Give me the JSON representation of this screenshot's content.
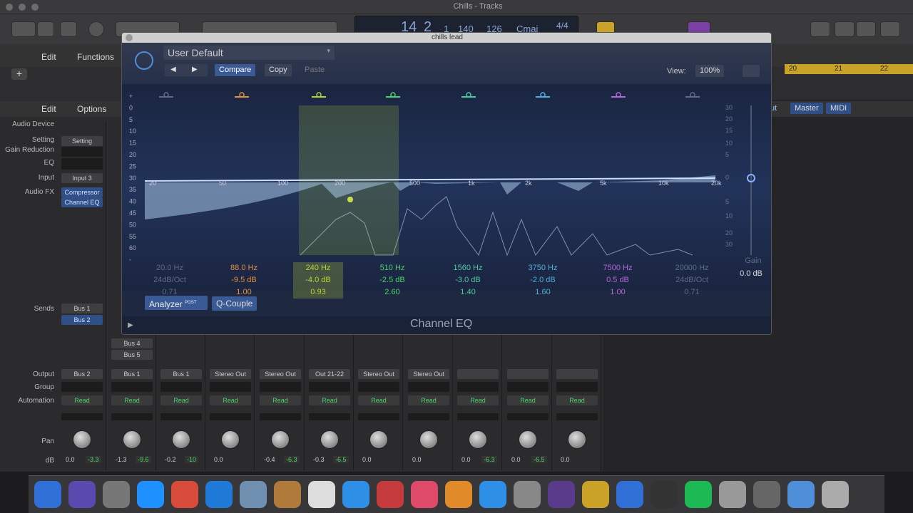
{
  "window": {
    "title": "Chills - Tracks"
  },
  "lcd": {
    "bar": "14",
    "beat": "2",
    "div": "1",
    "tick": "140",
    "tempo": "126",
    "key": "Cmaj",
    "sig": "4/4"
  },
  "tracks_header": {
    "edit": "Edit",
    "functions": "Functions"
  },
  "ruler": [
    "20",
    "21",
    "22"
  ],
  "mixer_header": {
    "edit": "Edit",
    "options": "Options"
  },
  "right_header": [
    "ut",
    "Master",
    "MIDI"
  ],
  "row_labels": {
    "audio_device": "Audio Device",
    "setting": "Setting",
    "gain_reduction": "Gain Reduction",
    "eq": "EQ",
    "input": "Input",
    "audio_fx": "Audio FX",
    "sends": "Sends",
    "output": "Output",
    "group": "Group",
    "automation": "Automation",
    "pan": "Pan",
    "db": "dB"
  },
  "strip1": {
    "setting": "Setting",
    "input": "Input 3",
    "fx1": "Compressor",
    "fx2": "Channel EQ",
    "send1": "Bus 1",
    "send2": "Bus 2"
  },
  "strip2_sends": [
    "Bus 4",
    "Bus 5"
  ],
  "strips": [
    {
      "output": "Bus 2",
      "automation": "Read",
      "db": "0.0",
      "peak": "-3.3"
    },
    {
      "output": "Bus 1",
      "automation": "Read",
      "db": "-1.3",
      "peak": "-9.6"
    },
    {
      "output": "Bus 1",
      "automation": "Read",
      "db": "-0.2",
      "peak": "-10"
    },
    {
      "output": "Stereo Out",
      "automation": "Read",
      "db": "0.0",
      "peak": ""
    },
    {
      "output": "Stereo Out",
      "automation": "Read",
      "db": "-0.4",
      "peak": "-6.3"
    },
    {
      "output": "Out 21-22",
      "automation": "Read",
      "db": "-0.3",
      "peak": "-6.5"
    },
    {
      "output": "Stereo Out",
      "automation": "Read",
      "db": "0.0",
      "peak": ""
    },
    {
      "output": "Stereo Out",
      "automation": "Read",
      "db": "0.0",
      "peak": ""
    },
    {
      "output": "",
      "automation": "Read",
      "db": "0.0",
      "peak": "-6.3"
    },
    {
      "output": "",
      "automation": "Read",
      "db": "0.0",
      "peak": "-6.5"
    },
    {
      "output": "",
      "automation": "Read",
      "db": "0.0",
      "peak": ""
    }
  ],
  "eq": {
    "window_title": "chills lead",
    "preset": "User Default",
    "compare": "Compare",
    "copy": "Copy",
    "paste": "Paste",
    "view_label": "View:",
    "view_value": "100%",
    "freq_labels": [
      "20",
      "50",
      "100",
      "200",
      "500",
      "1k",
      "2k",
      "5k",
      "10k",
      "20k"
    ],
    "db_left": [
      "+",
      "0",
      "5",
      "10",
      "15",
      "20",
      "25",
      "30",
      "35",
      "40",
      "45",
      "50",
      "55",
      "60",
      "-"
    ],
    "db_right": [
      "30",
      "20",
      "15",
      "10",
      "5",
      "0",
      "5",
      "10",
      "20",
      "30"
    ],
    "bands": [
      {
        "freq": "20.0 Hz",
        "gain": "24dB/Oct",
        "q": "0.71",
        "color": "#5f6b82"
      },
      {
        "freq": "88.0 Hz",
        "gain": "-9.5 dB",
        "q": "1.00",
        "color": "#e09040"
      },
      {
        "freq": "240 Hz",
        "gain": "-4.0 dB",
        "q": "0.93",
        "color": "#b8d23a"
      },
      {
        "freq": "510 Hz",
        "gain": "-2.5 dB",
        "q": "2.60",
        "color": "#4cd26b"
      },
      {
        "freq": "1560 Hz",
        "gain": "-3.0 dB",
        "q": "1.40",
        "color": "#4fc9a0"
      },
      {
        "freq": "3750 Hz",
        "gain": "-2.0 dB",
        "q": "1.60",
        "color": "#4fb0d8"
      },
      {
        "freq": "7500 Hz",
        "gain": "0.5 dB",
        "q": "1.00",
        "color": "#b766d8"
      },
      {
        "freq": "20000 Hz",
        "gain": "24dB/Oct",
        "q": "0.71",
        "color": "#5f6b82"
      }
    ],
    "gain_label": "Gain",
    "gain_value": "0.0 dB",
    "analyzer": "Analyzer",
    "analyzer_post": "POST",
    "qcouple": "Q-Couple",
    "plugin_name": "Channel EQ"
  }
}
